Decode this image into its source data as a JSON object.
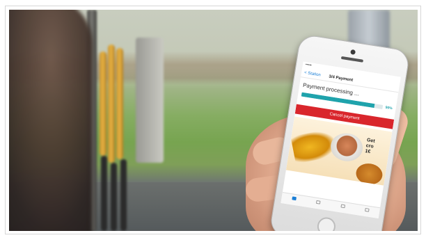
{
  "photo": {
    "subject": "hand holding smartphone at gas station"
  },
  "phone_app": {
    "status_bar": {
      "carrier": "••••• ",
      "time": "",
      "battery": ""
    },
    "nav": {
      "back_label": "< Station",
      "title": "3/4 Payment"
    },
    "processing_text": "Payment processing ...",
    "progress_label": "",
    "progress": {
      "percent": 90,
      "percent_label": "90%"
    },
    "cancel_label": "Cancel payment",
    "ad": {
      "headline_line1": "Get",
      "headline_line2": "cro",
      "headline_line3": "1€"
    },
    "tabs": [
      {
        "icon": "pump-icon",
        "active": true
      },
      {
        "icon": "receipt-icon",
        "active": false
      },
      {
        "icon": "map-icon",
        "active": false
      },
      {
        "icon": "account-icon",
        "active": false
      }
    ]
  }
}
